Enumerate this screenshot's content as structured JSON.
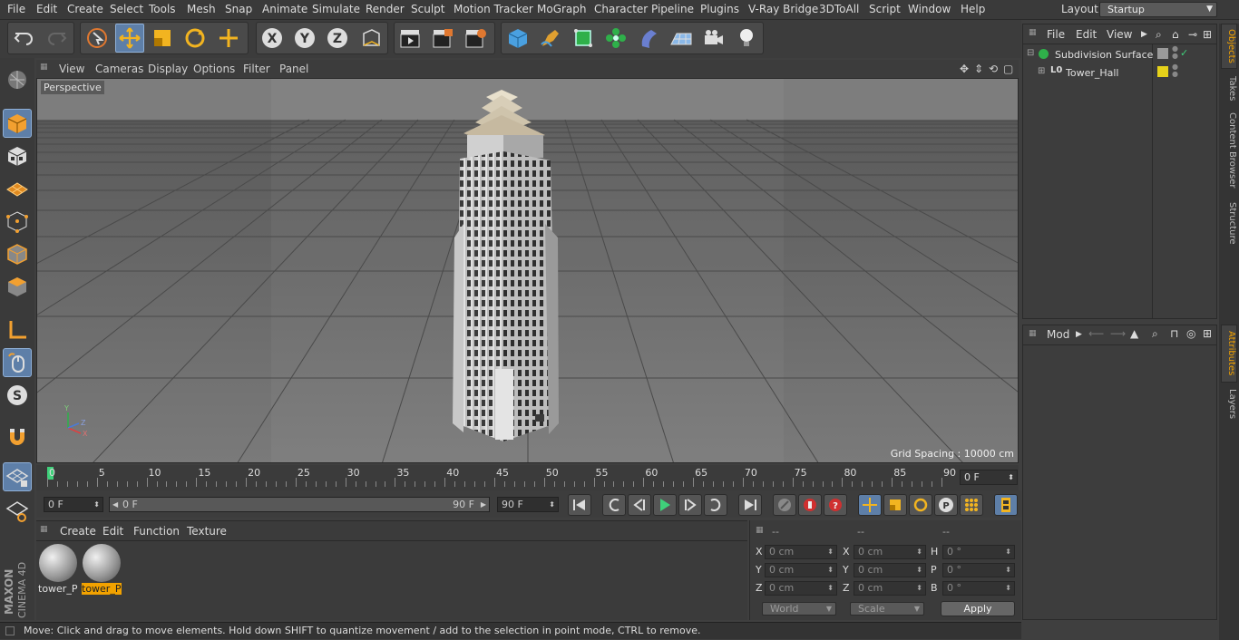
{
  "menu": [
    "File",
    "Edit",
    "Create",
    "Select",
    "Tools",
    "Mesh",
    "Snap",
    "Animate",
    "Simulate",
    "Render",
    "Sculpt",
    "Motion Tracker",
    "MoGraph",
    "Character",
    "Pipeline",
    "Plugins",
    "V-Ray Bridge",
    "3DToAll",
    "Script",
    "Window",
    "Help"
  ],
  "layout": {
    "label": "Layout:",
    "value": "Startup"
  },
  "viewport": {
    "menu": [
      "View",
      "Cameras",
      "Display",
      "Options",
      "Filter",
      "Panel"
    ],
    "camera_label": "Perspective",
    "grid_spacing": "Grid Spacing : 10000 cm"
  },
  "timeline": {
    "ticks": [
      "0",
      "5",
      "10",
      "15",
      "20",
      "25",
      "30",
      "35",
      "40",
      "45",
      "50",
      "55",
      "60",
      "65",
      "70",
      "75",
      "80",
      "85",
      "90"
    ],
    "current_frame": "0 F"
  },
  "transport": {
    "start_field": "0 F",
    "range_start": "0 F",
    "range_end": "90 F",
    "end_field": "90 F"
  },
  "materials": {
    "menu": [
      "Create",
      "Edit",
      "Function",
      "Texture"
    ],
    "items": [
      {
        "name": "tower_P",
        "selected": false
      },
      {
        "name": "tower_P",
        "selected": true
      }
    ]
  },
  "coords": {
    "headers": [
      "--",
      "--",
      "--"
    ],
    "rows": [
      {
        "a": "X",
        "av": "0 cm",
        "b": "X",
        "bv": "0 cm",
        "c": "H",
        "cv": "0 °"
      },
      {
        "a": "Y",
        "av": "0 cm",
        "b": "Y",
        "bv": "0 cm",
        "c": "P",
        "cv": "0 °"
      },
      {
        "a": "Z",
        "av": "0 cm",
        "b": "Z",
        "bv": "0 cm",
        "c": "B",
        "cv": "0 °"
      }
    ],
    "space": "World",
    "mode": "Scale",
    "apply": "Apply"
  },
  "objects": {
    "menu": [
      "File",
      "Edit",
      "View"
    ],
    "items": [
      {
        "name": "Subdivision Surface",
        "color": "#9a9a9a"
      },
      {
        "name": "Tower_Hall",
        "color": "#e6d21a"
      }
    ]
  },
  "attributes": {
    "mode": "Mod"
  },
  "side_tabs": [
    "Objects",
    "Takes",
    "Content Browser",
    "Structure",
    "Attributes",
    "Layers"
  ],
  "status": "Move: Click and drag to move elements. Hold down SHIFT to quantize movement / add to the selection in point mode, CTRL to remove.",
  "brand": {
    "line1": "MAXON",
    "line2": "CINEMA 4D"
  },
  "colors": {
    "accent": "#5e7fa8",
    "selection": "#f2a200",
    "timeline_marker": "#3fd07a"
  }
}
